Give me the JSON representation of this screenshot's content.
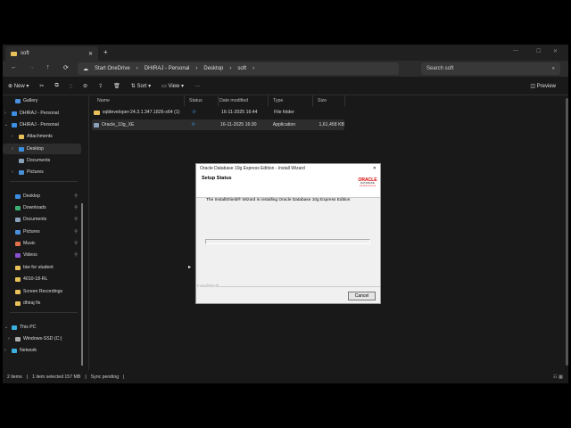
{
  "window": {
    "tab_title": "soft",
    "new_tab": "+",
    "controls": [
      "—",
      "☐",
      "✕"
    ]
  },
  "address": {
    "nav": [
      "←",
      "→",
      "↑",
      "⟳"
    ],
    "path": [
      "Start OneDrive",
      "DHIRAJ - Personal",
      "Desktop",
      "soft"
    ],
    "search_placeholder": "Search soft"
  },
  "toolbar": {
    "new": "New",
    "sort": "Sort",
    "view": "View",
    "more": "···",
    "preview": "Preview"
  },
  "sidebar": {
    "items": [
      {
        "label": "Gallery",
        "color": "#4a90d9"
      },
      {
        "label": "DHIRAJ - Personal",
        "color": "#3b8ee0"
      },
      {
        "label": "DHIRAJ - Personal",
        "color": "#3b8ee0"
      },
      {
        "label": "Attachments",
        "color": "#e8c15a"
      },
      {
        "label": "Desktop",
        "color": "#3b8ee0"
      },
      {
        "label": "Documents",
        "color": "#8aa0b8"
      },
      {
        "label": "Pictures",
        "color": "#4a90d9"
      },
      {
        "label": "Desktop",
        "color": "#3b8ee0"
      },
      {
        "label": "Downloads",
        "color": "#3bb070"
      },
      {
        "label": "Documents",
        "color": "#8aa0b8"
      },
      {
        "label": "Pictures",
        "color": "#4a90d9"
      },
      {
        "label": "Music",
        "color": "#e0704a"
      },
      {
        "label": "Videos",
        "color": "#8a50d0"
      },
      {
        "label": "biw for student",
        "color": "#e8c15a"
      },
      {
        "label": "4010-18-RL",
        "color": "#e8c15a"
      },
      {
        "label": "Screen Recordings",
        "color": "#e8c15a"
      },
      {
        "label": "dhiraj fix",
        "color": "#e8c15a"
      },
      {
        "label": "This PC",
        "color": "#3bb0e0"
      },
      {
        "label": "Windows-SSD (C:)",
        "color": "#aaa"
      },
      {
        "label": "Network",
        "color": "#3bb0e0"
      }
    ]
  },
  "columns": [
    "Name",
    "Status",
    "Date modified",
    "Type",
    "Size"
  ],
  "files": [
    {
      "name": "sqldeveloper-24.3.1.347.1826-x64 (1)",
      "date": "16-11-2025 16:44",
      "type": "File folder",
      "size": ""
    },
    {
      "name": "Oracle_10g_XE",
      "date": "16-11-2025 16:30",
      "type": "Application",
      "size": "1,61,458 KB"
    }
  ],
  "status": {
    "items": "2 items",
    "selected": "1 item selected  157 MB",
    "sync": "Sync pending"
  },
  "dialog": {
    "title": "Oracle Database 10g Express Edition - Install Wizard",
    "heading": "Setup Status",
    "logo": "ORACLE DATABASE EXPRESS EDITION",
    "message": "The InstallShield® Wizard is installing Oracle Database 10g Express Edition",
    "progress": 0,
    "brand": "InstallShield",
    "cancel": "Cancel",
    "close": "✕"
  }
}
